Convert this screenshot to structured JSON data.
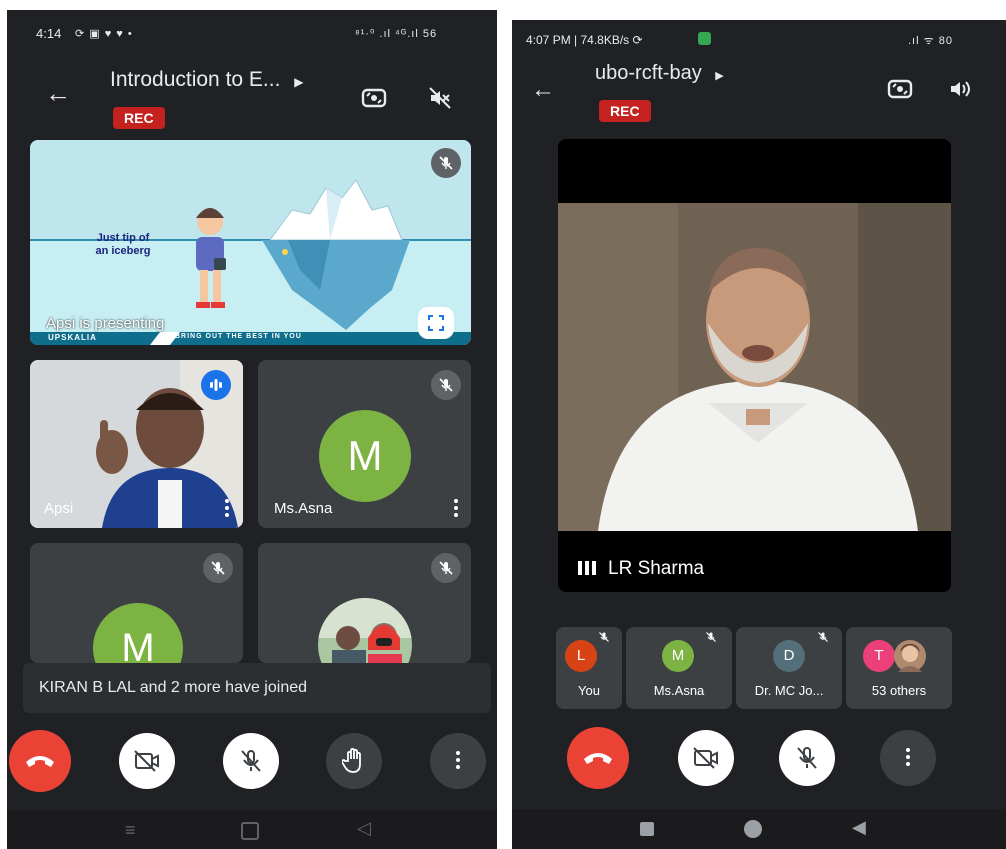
{
  "left": {
    "status": {
      "time": "4:14",
      "icons": "⟳ ▣ ♥ ♥ •",
      "right": "⁸¹·⁰ .ıl ⁴ᴳ.ıl 56"
    },
    "title": "Introduction to E...",
    "rec": "REC",
    "presentation": {
      "slide_text_line1": "Just tip of",
      "slide_text_line2": "an iceberg",
      "presenting_label": "Apsi is presenting",
      "ribbon_left": "UPSKALIA",
      "ribbon_right": "BRING OUT THE BEST IN YOU"
    },
    "tiles": [
      {
        "name": "Apsi"
      },
      {
        "name": "Ms.Asna",
        "initial": "M"
      },
      {
        "name": "",
        "initial": "M"
      },
      {
        "name": ""
      }
    ],
    "notification": "KIRAN B LAL and 2 more have joined",
    "colors": {
      "background": "#202124",
      "tile": "#3c4043",
      "end_call": "#ea4335",
      "avatar_green": "#7cb342",
      "active_speaker": "#1a73e8"
    }
  },
  "right": {
    "status": {
      "time_line": "4:07 PM | 74.8KB/s ⟳",
      "right": ".ıl ᯤ 80"
    },
    "title": "ubo-rcft-bay",
    "rec": "REC",
    "speaker_name": "LR Sharma",
    "participants": [
      {
        "initial": "L",
        "label": "You",
        "color": "#d84315"
      },
      {
        "initial": "M",
        "label": "Ms.Asna",
        "color": "#7cb342"
      },
      {
        "initial": "D",
        "label": "Dr. MC Jo...",
        "color": "#546e7a"
      },
      {
        "initial": "T",
        "label": "53 others",
        "color": "#ec407a"
      }
    ]
  }
}
